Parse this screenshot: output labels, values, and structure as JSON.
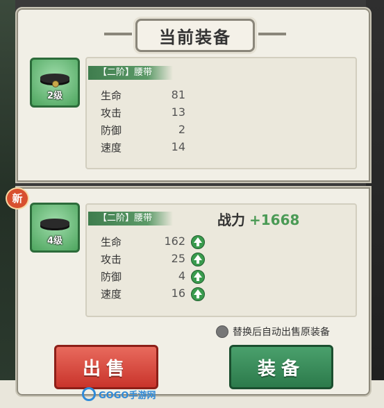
{
  "header": {
    "title": "当前装备"
  },
  "current_item": {
    "level": "2级",
    "name": "【二阶】腰带",
    "stats": [
      {
        "label": "生命",
        "value": "81"
      },
      {
        "label": "攻击",
        "value": "13"
      },
      {
        "label": "防御",
        "value": "2"
      },
      {
        "label": "速度",
        "value": "14"
      }
    ]
  },
  "new_item": {
    "badge": "新",
    "level": "4级",
    "name": "【二阶】腰带",
    "power_label": "战力",
    "power_delta": "+1668",
    "stats": [
      {
        "label": "生命",
        "value": "162"
      },
      {
        "label": "攻击",
        "value": "25"
      },
      {
        "label": "防御",
        "value": "4"
      },
      {
        "label": "速度",
        "value": "16"
      }
    ]
  },
  "options": {
    "auto_sell_label": "替换后自动出售原装备"
  },
  "buttons": {
    "sell": "出售",
    "equip": "装备"
  },
  "watermark": {
    "text": "GOGO手游网"
  },
  "colors": {
    "sell": "#d0392f",
    "equip": "#2f7d4e",
    "increase": "#4a9a55"
  }
}
